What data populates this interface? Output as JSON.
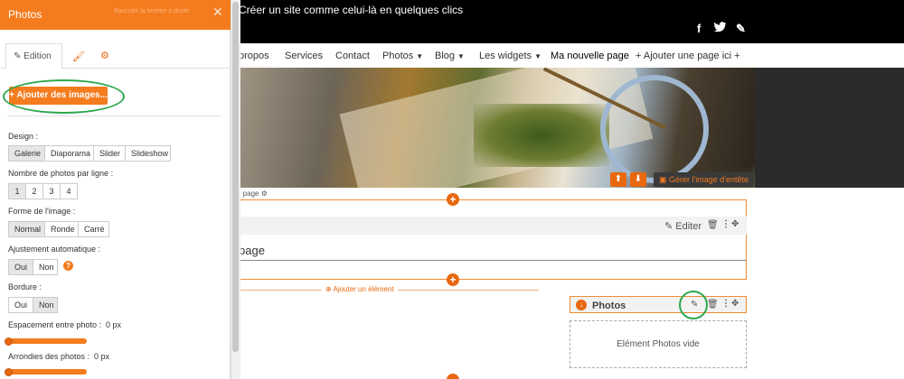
{
  "site": {
    "tagline": "Créer un site comme celui-là en quelques clics",
    "social": [
      {
        "icon": "facebook-icon",
        "glyph": "f"
      },
      {
        "icon": "twitter-icon",
        "glyph": "🐦"
      },
      {
        "icon": "pencil-icon",
        "glyph": "✎"
      }
    ],
    "nav": {
      "apropos": "propos",
      "services": "Services",
      "contact": "Contact",
      "photos": "Photos",
      "blog": "Blog",
      "widgets": "Les widgets",
      "new_page": "Ma nouvelle page",
      "add_page": "+ Ajouter une page ici +"
    },
    "header": {
      "up_icon": "arrow-up-icon",
      "down_icon": "arrow-down-icon",
      "manage_label": "Gérer l'image d'entête"
    },
    "page_options": "e page",
    "editor": {
      "edit_label": "Editer",
      "page_text": "page",
      "add_element": "Ajouter un élément"
    },
    "photos_widget": {
      "title": "Photos",
      "empty": "Elément Photos vide"
    }
  },
  "panel": {
    "title": "Photos",
    "dock_right": "Basculer la fenêtre à droite",
    "close": "✕",
    "tabs": {
      "edition": "Edition"
    },
    "add_images": "+ Ajouter des images...",
    "design": {
      "label": "Design :",
      "options": [
        "Galerie",
        "Diaporama",
        "Slider",
        "Slideshow"
      ],
      "selected": "Galerie"
    },
    "photos_per_row": {
      "label": "Nombre de photos par ligne :",
      "options": [
        "1",
        "2",
        "3",
        "4"
      ],
      "selected": "1"
    },
    "image_shape": {
      "label": "Forme de l'image :",
      "options": [
        "Normal",
        "Ronde",
        "Carré"
      ],
      "selected": "Normal"
    },
    "auto_adjust": {
      "label": "Ajustement automatique :",
      "options": [
        "Oui",
        "Non"
      ],
      "selected": "Oui"
    },
    "border": {
      "label": "Bordure :",
      "options": [
        "Oui",
        "Non"
      ],
      "selected": "Non"
    },
    "spacing": {
      "label": "Espacement entre photo :",
      "value": "0 px"
    },
    "rounding": {
      "label": "Arrondies des photos :",
      "value": "0 px"
    }
  },
  "colors": {
    "accent": "#f47c1e",
    "highlight_ring": "#2fa84f"
  }
}
